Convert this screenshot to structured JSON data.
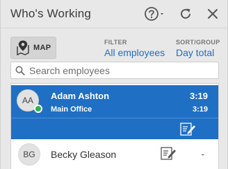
{
  "header": {
    "title": "Who's Working",
    "help_icon": "help-dropdown-icon",
    "refresh_icon": "refresh-icon",
    "close_icon": "close-icon"
  },
  "toolbar": {
    "map_label": "MAP",
    "map_icon": "map-pin-icon",
    "filter_label": "FILTER",
    "filter_value": "All employees",
    "sort_label": "SORT/GROUP",
    "sort_value": "Day total"
  },
  "search": {
    "placeholder": "Search employees",
    "value": "",
    "icon": "search-icon"
  },
  "employees": [
    {
      "initials": "AA",
      "name": "Adam Ashton",
      "location": "Main Office",
      "time": "3:19",
      "day_total": "3:19",
      "status": "online",
      "selected": true
    },
    {
      "initials": "BG",
      "name": "Becky Gleason",
      "time": "-",
      "selected": false
    }
  ],
  "colors": {
    "accent": "#1f6fc5",
    "link": "#1c6fc4",
    "status_online": "#2fb24a",
    "background": "#e8e8e8"
  }
}
